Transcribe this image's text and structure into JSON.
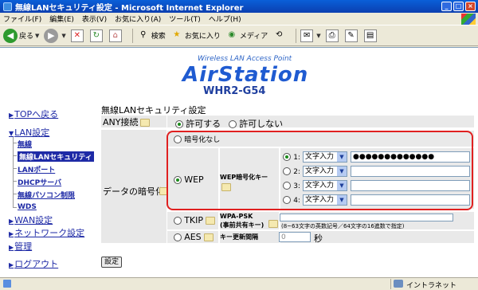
{
  "window": {
    "title": "無線LANセキュリティ設定 - Microsoft Internet Explorer",
    "min": "_",
    "max": "□",
    "close": "×"
  },
  "menu": [
    "ファイル(F)",
    "編集(E)",
    "表示(V)",
    "お気に入り(A)",
    "ツール(T)",
    "ヘルプ(H)"
  ],
  "toolbar": {
    "back": "戻る",
    "search": "検索",
    "favorites": "お気に入り",
    "media": "メディア"
  },
  "logo": {
    "sub": "Wireless LAN Access Point",
    "main": "AirStation",
    "model": "WHR2-G54"
  },
  "nav": {
    "top": "TOPへ戻る",
    "lan": "LAN設定",
    "lan_items": [
      "無線",
      "無線LANセキュリティ",
      "LANポート",
      "DHCPサーバ",
      "無線パソコン制限",
      "WDS"
    ],
    "wan": "WAN設定",
    "network": "ネットワーク設定",
    "admin": "管理",
    "logout": "ログアウト"
  },
  "form": {
    "title": "無線LANセキュリティ設定",
    "any_label": "ANY接続",
    "any_allow": "許可する",
    "any_deny": "許可しない",
    "encryption_label": "データの暗号化",
    "none": "暗号化なし",
    "wep": "WEP",
    "wep_key_label": "WEP暗号化キー",
    "keys": [
      {
        "num": "1:",
        "type": "文字入力",
        "value": "●●●●●●●●●●●●●",
        "selected": true
      },
      {
        "num": "2:",
        "type": "文字入力",
        "value": "",
        "selected": false
      },
      {
        "num": "3:",
        "type": "文字入力",
        "value": "",
        "selected": false
      },
      {
        "num": "4:",
        "type": "文字入力",
        "value": "",
        "selected": false
      }
    ],
    "tkip": "TKIP",
    "psk_label_1": "WPA-PSK",
    "psk_label_2": "(事前共有キー)",
    "psk_hint": "(8~63文字の英数記号／64文字の16進数で指定)",
    "aes": "AES",
    "interval_label": "キー更新間隔",
    "interval_value": "0",
    "interval_unit": "秒",
    "submit": "設定"
  },
  "status": {
    "zone": "イントラネット"
  }
}
